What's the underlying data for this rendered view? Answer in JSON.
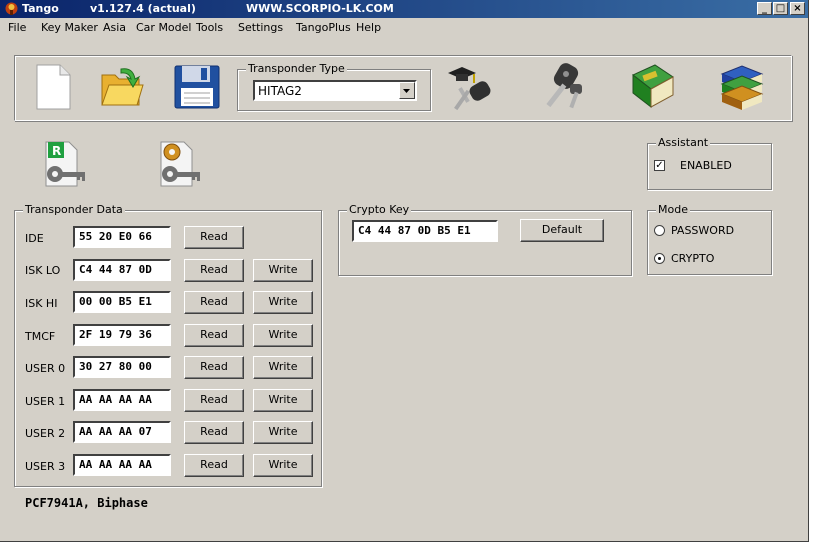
{
  "titlebar": {
    "app": "Tango",
    "version": "v1.127.4  (actual)",
    "site": "WWW.SCORPIO-LK.COM",
    "minimize": "_",
    "maximize": "□",
    "close": "×"
  },
  "menu": [
    "File",
    "Key Maker",
    "Asia",
    "Car Model",
    "Tools",
    "Settings",
    "TangoPlus",
    "Help"
  ],
  "transponder_type": {
    "legend": "Transponder Type",
    "value": "HITAG2"
  },
  "assistant": {
    "legend": "Assistant",
    "checkbox_label": "ENABLED",
    "checked": true
  },
  "transponder_data": {
    "legend": "Transponder Data",
    "rows": [
      {
        "label": "IDE",
        "value": "55 20 E0 66",
        "read": "Read",
        "write": ""
      },
      {
        "label": "ISK LO",
        "value": "C4 44 87 0D",
        "read": "Read",
        "write": "Write"
      },
      {
        "label": "ISK HI",
        "value": "00 00 B5 E1",
        "read": "Read",
        "write": "Write"
      },
      {
        "label": "TMCF",
        "value": "2F 19 79 36",
        "read": "Read",
        "write": "Write"
      },
      {
        "label": "USER 0",
        "value": "30 27 80 00",
        "read": "Read",
        "write": "Write"
      },
      {
        "label": "USER 1",
        "value": "AA AA AA AA",
        "read": "Read",
        "write": "Write"
      },
      {
        "label": "USER 2",
        "value": "AA AA AA 07",
        "read": "Read",
        "write": "Write"
      },
      {
        "label": "USER 3",
        "value": "AA AA AA AA",
        "read": "Read",
        "write": "Write"
      }
    ]
  },
  "crypto_key": {
    "legend": "Crypto Key",
    "value": "C4 44 87 0D B5 E1",
    "default_label": "Default"
  },
  "mode": {
    "legend": "Mode",
    "options": [
      "PASSWORD",
      "CRYPTO"
    ],
    "selected": "CRYPTO"
  },
  "status": "PCF7941A, Biphase",
  "colors": {
    "window_bg": "#d4d0c8",
    "title_start": "#0a246a",
    "title_end": "#3a6ea5"
  }
}
